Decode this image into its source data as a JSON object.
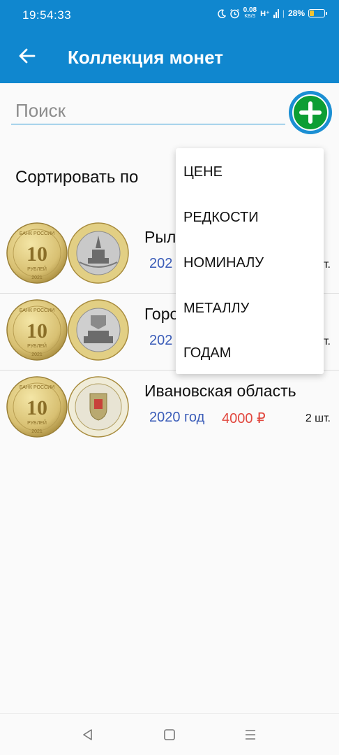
{
  "status_bar": {
    "time": "19:54:33",
    "speed_value": "0.08",
    "speed_unit": "KB/S",
    "network": "H⁺",
    "battery": "28%"
  },
  "app_bar": {
    "title": "Коллекция монет",
    "back_icon": "arrow-back-icon"
  },
  "search": {
    "placeholder": "Поиск",
    "value": ""
  },
  "add_button": {
    "icon": "plus-icon",
    "color": "#0d9e34"
  },
  "sort": {
    "label": "Сортировать по",
    "options": [
      "ЦЕНЕ",
      "РЕДКОСТИ",
      "НОМИНАЛУ",
      "МЕТАЛЛУ",
      "ГОДАМ"
    ]
  },
  "coins": [
    {
      "name": "Рыл",
      "year": "202",
      "price": "",
      "qty": "шт."
    },
    {
      "name": "Горо",
      "year": "202",
      "price": "",
      "qty": "шт."
    },
    {
      "name": "Ивановская область",
      "year": "2020 год",
      "price": "4000 ₽",
      "qty": "2 шт."
    }
  ],
  "coin_faces": {
    "front_top": "БАНК РОССИИ",
    "front_value": "10",
    "front_unit": "РУБЛЕЙ",
    "front_year": "2021"
  },
  "colors": {
    "primary": "#1087cf",
    "year_text": "#3a5cb8",
    "price_text": "#e1473e"
  }
}
